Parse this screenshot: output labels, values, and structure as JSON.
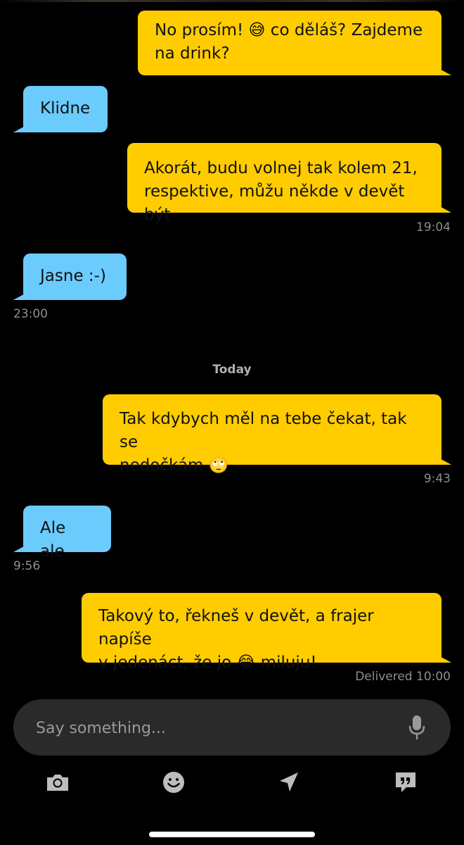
{
  "colors": {
    "outgoing_bubble": "#ffcc00",
    "incoming_bubble": "#6ccbfd",
    "background": "#000000",
    "timestamp": "#8e8e8e"
  },
  "messages": [
    {
      "direction": "outgoing",
      "text": "No prosím! 😅 co děláš? Zajdeme\nna drink?"
    },
    {
      "direction": "incoming",
      "text": "Klidne"
    },
    {
      "direction": "outgoing",
      "text": "Akorát, budu volnej tak kolem 21,\nrespektive, můžu někde v devět být",
      "time": "19:04"
    },
    {
      "direction": "incoming",
      "text": "Jasne :-)",
      "time": "23:00"
    },
    {
      "direction": "outgoing",
      "text": "Tak kdybych měl na tebe čekat, tak se\nnedočkám 🙄",
      "time": "9:43"
    },
    {
      "direction": "incoming",
      "text": "Ale ale",
      "time": "9:56"
    },
    {
      "direction": "outgoing",
      "text": "Takový to, řekneš v devět, a frajer napíše\nv jedenáct, že jo 😂 miluju!",
      "time": "Delivered 10:00"
    }
  ],
  "day_separator": "Today",
  "composer": {
    "placeholder": "Say something...",
    "mic_icon": "microphone-icon"
  },
  "toolbar": {
    "icons": [
      "camera-icon",
      "emoji-icon",
      "location-arrow-icon",
      "quick-replies-icon"
    ]
  }
}
